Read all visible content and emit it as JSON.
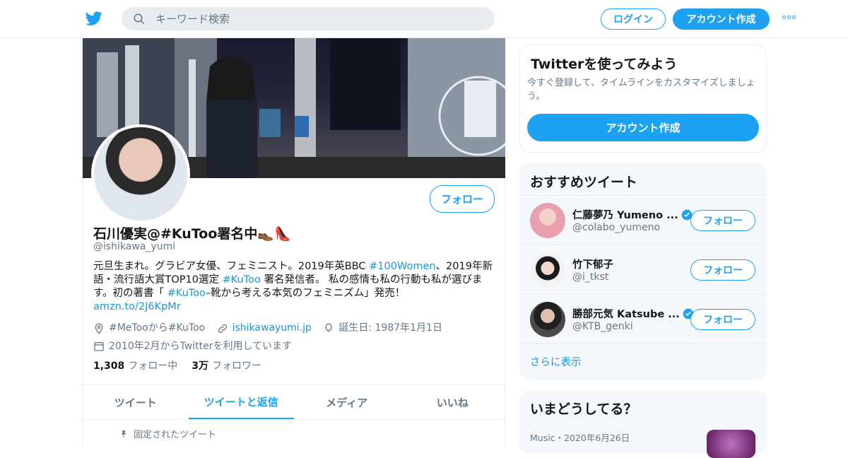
{
  "header": {
    "search_placeholder": "キーワード検索",
    "login_label": "ログイン",
    "signup_label": "アカウント作成"
  },
  "profile": {
    "name": "石川優実@#KuToo署名中👞👠",
    "handle": "@ishikawa_yumi",
    "follow_label": "フォロー",
    "bio": {
      "part1": "元旦生まれ。グラビア女優、フェミニスト。2019年英BBC ",
      "tag1": "#100Women",
      "part2": "、2019年新語・流行語大賞TOP10選定 ",
      "tag2": "#KuToo",
      "part3": " 署名発信者。 私の感情も私の行動も私が選びます。初の著書「 ",
      "tag3": "#KuToo",
      "part4": "–靴から考える本気のフェミニズム」発売！",
      "link": "amzn.to/2J6KpMr"
    },
    "location": "#MeTooから#KuToo",
    "website": "ishikawayumi.jp",
    "birthday": "誕生日: 1987年1月1日",
    "joined": "2010年2月からTwitterを利用しています",
    "following_count": "1,308",
    "following_label": "フォロー中",
    "followers_count": "3万",
    "followers_label": "フォロワー"
  },
  "tabs": [
    {
      "label": "ツイート"
    },
    {
      "label": "ツイートと返信"
    },
    {
      "label": "メディア"
    },
    {
      "label": "いいね"
    }
  ],
  "pinned_label": "固定されたツイート",
  "signup_card": {
    "title": "Twitterを使ってみよう",
    "text": "今すぐ登録して、タイムラインをカスタマイズしましょう。",
    "button": "アカウント作成"
  },
  "recommend": {
    "title": "おすすめツイート",
    "users": [
      {
        "name": "仁藤夢乃 Yumeno ...",
        "handle": "@colabo_yumeno",
        "verified": true,
        "follow": "フォロー"
      },
      {
        "name": "竹下郁子",
        "handle": "@i_tkst",
        "verified": false,
        "follow": "フォロー"
      },
      {
        "name": "勝部元気 Katsube ...",
        "handle": "@KTB_genki",
        "verified": true,
        "follow": "フォロー"
      }
    ],
    "more": "さらに表示"
  },
  "trends": {
    "title": "いまどうしてる？",
    "meta": "Music・2020年6月26日"
  },
  "colors": {
    "accent": "#1da1f2",
    "link": "#1b95e0",
    "muted": "#657786"
  }
}
